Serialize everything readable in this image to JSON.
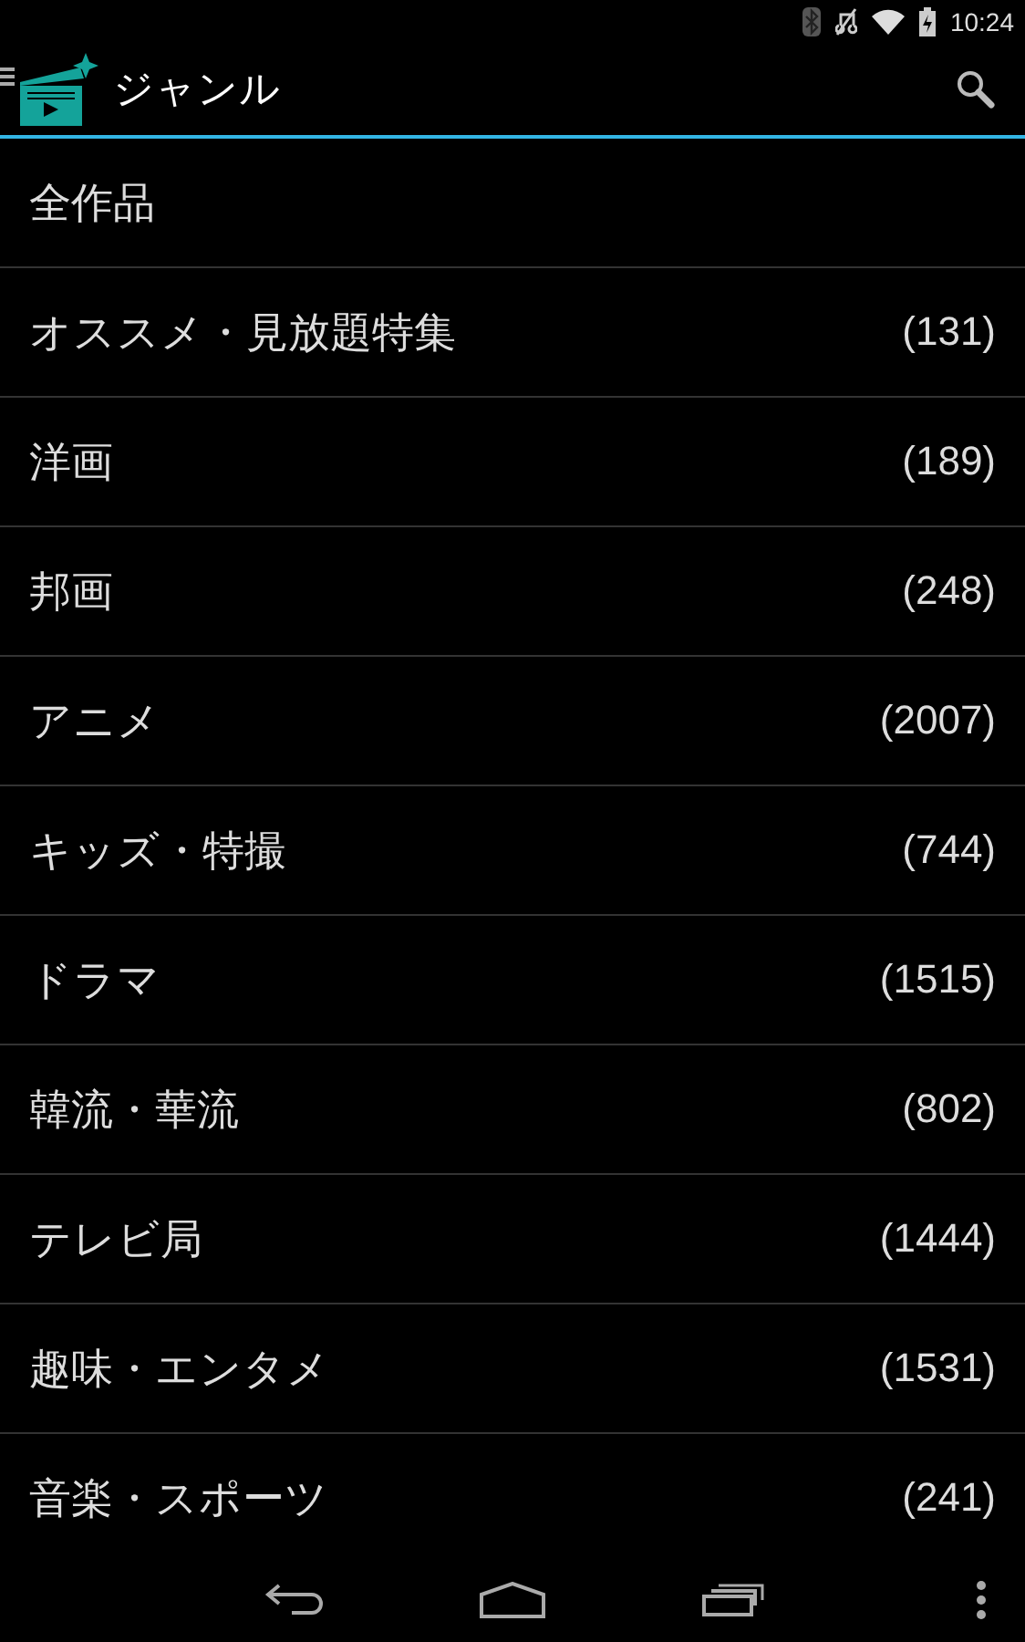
{
  "status_bar": {
    "time": "10:24"
  },
  "action_bar": {
    "title": "ジャンル"
  },
  "genres": [
    {
      "name": "全作品"
    },
    {
      "name": "オススメ・見放題特集",
      "count": "(131)"
    },
    {
      "name": "洋画",
      "count": "(189)"
    },
    {
      "name": "邦画",
      "count": "(248)"
    },
    {
      "name": "アニメ",
      "count": "(2007)"
    },
    {
      "name": "キッズ・特撮",
      "count": "(744)"
    },
    {
      "name": "ドラマ",
      "count": "(1515)"
    },
    {
      "name": "韓流・華流",
      "count": "(802)"
    },
    {
      "name": "テレビ局",
      "count": "(1444)"
    },
    {
      "name": "趣味・エンタメ",
      "count": "(1531)"
    },
    {
      "name": "音楽・スポーツ",
      "count": "(241)"
    }
  ]
}
